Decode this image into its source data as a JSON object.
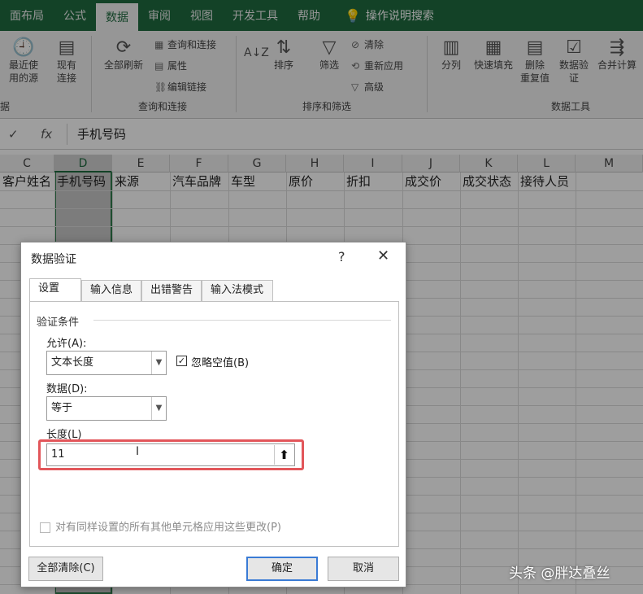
{
  "menubar": {
    "tabs": [
      "面布局",
      "公式",
      "数据",
      "审阅",
      "视图",
      "开发工具",
      "帮助"
    ],
    "active_tab": "数据",
    "search_label": "操作说明搜索"
  },
  "ribbon": {
    "recent_sources": "最近使\n用的源",
    "existing_conn": "现有\n连接",
    "refresh_all": "全部刷新",
    "queries_conn": "查询和连接",
    "properties": "属性",
    "edit_links": "编辑链接",
    "group_query": "查询和连接",
    "sort": "排序",
    "filter": "筛选",
    "clear": "清除",
    "reapply": "重新应用",
    "advanced": "高级",
    "group_sort": "排序和筛选",
    "split": "分列",
    "flash_fill": "快速填充",
    "remove_dup": "删除\n重复值",
    "data_validation": "数据验\n证",
    "consolidate": "合并计算",
    "group_tools": "数据工具",
    "group_left": "据"
  },
  "formula_bar": {
    "content": "手机号码"
  },
  "sheet": {
    "columns": [
      "C",
      "D",
      "E",
      "F",
      "G",
      "H",
      "I",
      "J",
      "K",
      "L",
      "M"
    ],
    "header_row": [
      "客户姓名",
      "手机号码",
      "来源",
      "汽车品牌",
      "车型",
      "原价",
      "折扣",
      "成交价",
      "成交状态",
      "接待人员",
      ""
    ]
  },
  "dialog": {
    "title": "数据验证",
    "help": "?",
    "close": "✕",
    "tabs": [
      "设置",
      "输入信息",
      "出错警告",
      "输入法模式"
    ],
    "section": "验证条件",
    "allow_label": "允许(A):",
    "allow_value": "文本长度",
    "ignore_blank": "忽略空值(B)",
    "ignore_blank_checked": true,
    "data_label": "数据(D):",
    "data_value": "等于",
    "length_label": "长度(L)",
    "length_value": "11",
    "apply_all": "对有同样设置的所有其他单元格应用这些更改(P)",
    "clear_all": "全部清除(C)",
    "ok": "确定",
    "cancel": "取消"
  },
  "watermark": "头条 @胖达叠丝"
}
